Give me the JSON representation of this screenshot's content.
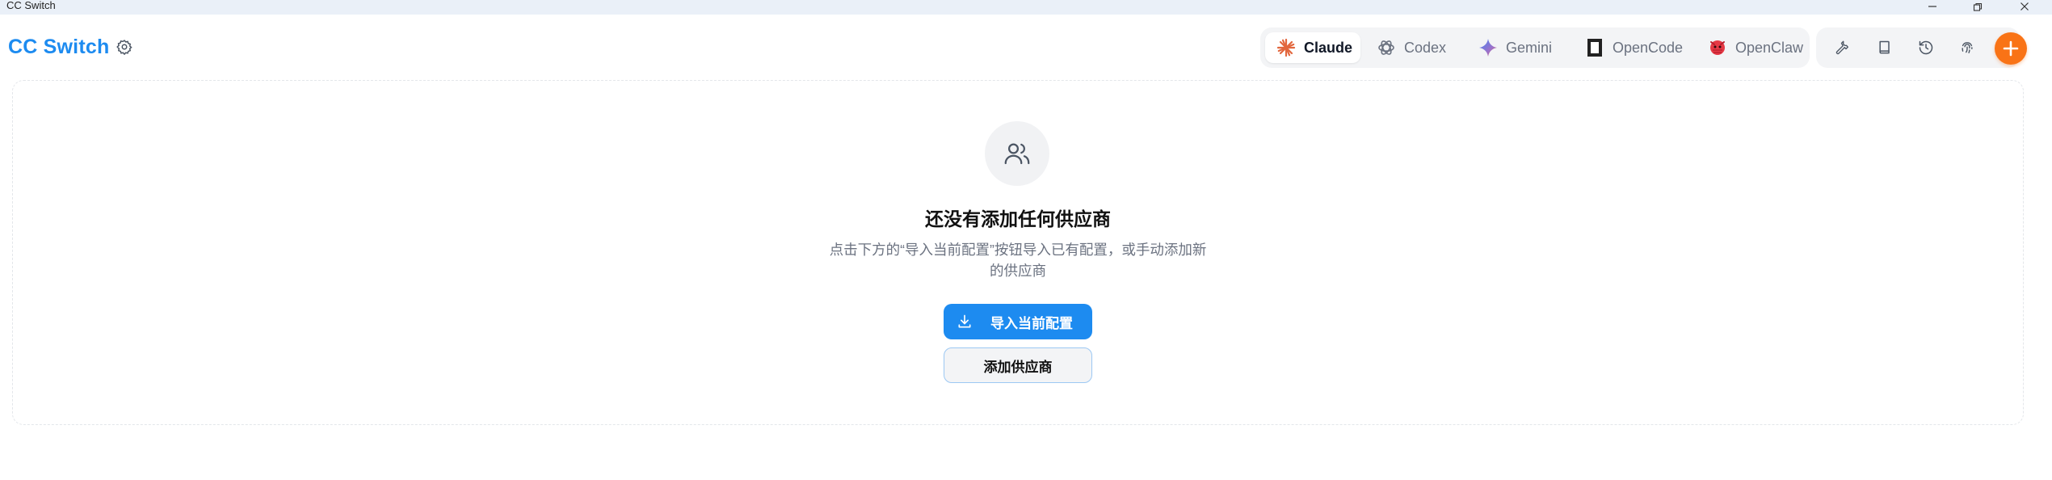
{
  "window": {
    "title": "CC Switch"
  },
  "header": {
    "brand": "CC Switch",
    "settings_icon": "gear-icon",
    "apps": [
      {
        "label": "Claude",
        "icon": "claude-icon",
        "active": true
      },
      {
        "label": "Codex",
        "icon": "openai-icon",
        "active": false
      },
      {
        "label": "Gemini",
        "icon": "gemini-icon",
        "active": false
      },
      {
        "label": "OpenCode",
        "icon": "opencode-icon",
        "active": false
      },
      {
        "label": "OpenClaw",
        "icon": "openclaw-icon",
        "active": false
      }
    ],
    "tools": [
      "wrench-icon",
      "book-icon",
      "history-icon",
      "fingerprint-icon"
    ],
    "add_icon": "plus-icon"
  },
  "empty_state": {
    "icon": "users-icon",
    "title": "还没有添加任何供应商",
    "description_line1": "点击下方的“导入当前配置”按钮导入已有配置，或手动添加新",
    "description_line2": "的供应商",
    "import_button": "导入当前配置",
    "add_button": "添加供应商"
  },
  "colors": {
    "accent": "#1d8bf0",
    "add": "#f97316",
    "claude": "#e2673e"
  }
}
